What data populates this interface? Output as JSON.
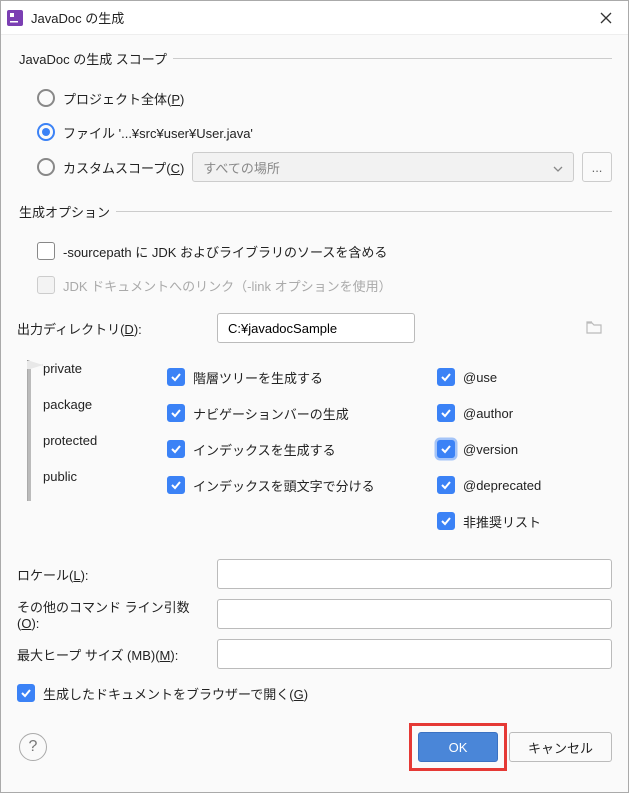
{
  "title": "JavaDoc の生成",
  "scope": {
    "legend": "JavaDoc の生成 スコープ",
    "project": "プロジェクト全体(P)",
    "file": "ファイル '...¥src¥user¥User.java'",
    "custom": "カスタムスコープ(C)",
    "customDropdown": "すべての場所"
  },
  "options": {
    "legend": "生成オプション",
    "sourcepath": "-sourcepath に JDK およびライブラリのソースを含める",
    "jdkLink": "JDK ドキュメントへのリンク（-link オプションを使用）"
  },
  "outputDir": {
    "label": "出力ディレクトリ(D):",
    "value": "C:¥javadocSample"
  },
  "access": {
    "private": "private",
    "package": "package",
    "protected": "protected",
    "public": "public"
  },
  "genOpts": {
    "hierarchy": "階層ツリーを生成する",
    "navbar": "ナビゲーションバーの生成",
    "index": "インデックスを生成する",
    "splitIndex": "インデックスを頭文字で分ける",
    "use": "@use",
    "author": "@author",
    "version": "@version",
    "deprecated": "@deprecated",
    "deprecatedList": "非推奨リスト"
  },
  "fields": {
    "locale": "ロケール(L):",
    "cmdArgs": "その他のコマンド ライン引数(O):",
    "maxHeap": "最大ヒープ サイズ (MB)(M):"
  },
  "openBrowser": "生成したドキュメントをブラウザーで開く(G)",
  "buttons": {
    "ok": "OK",
    "cancel": "キャンセル"
  }
}
